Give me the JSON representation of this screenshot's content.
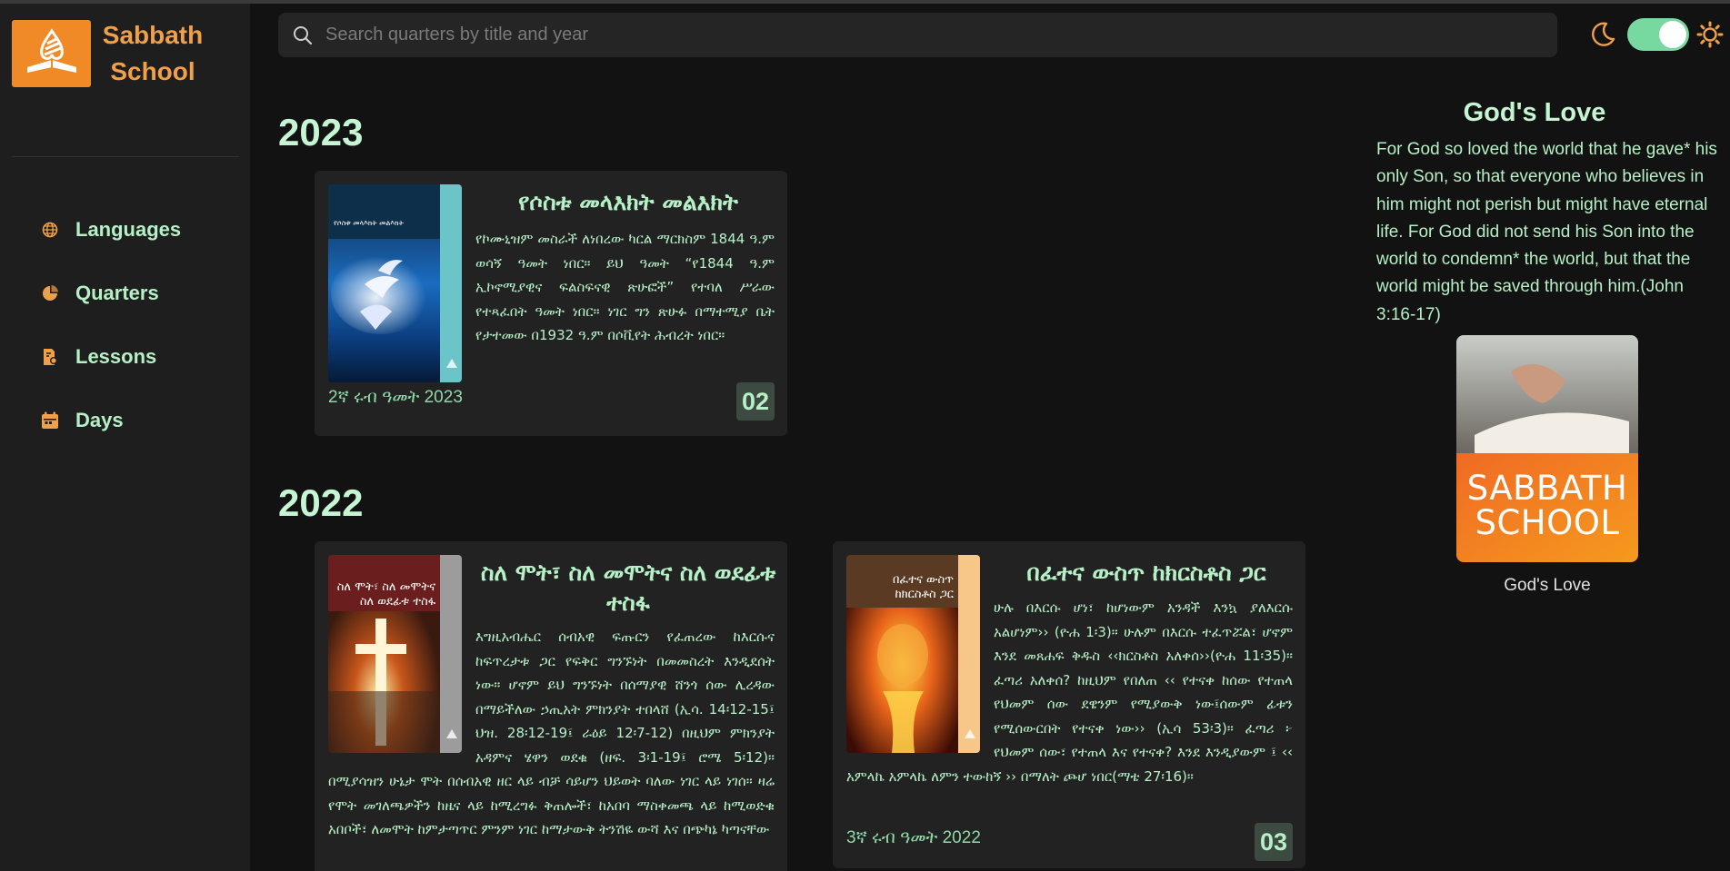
{
  "brand": {
    "line1": "Sabbath",
    "line2": "School"
  },
  "nav": [
    {
      "label": "Languages",
      "icon": "globe-icon"
    },
    {
      "label": "Quarters",
      "icon": "pie-icon"
    },
    {
      "label": "Lessons",
      "icon": "lesson-icon"
    },
    {
      "label": "Days",
      "icon": "calendar-icon"
    }
  ],
  "search": {
    "placeholder": "Search quarters by title and year"
  },
  "theme": {
    "moon_icon": "moon-icon",
    "sun_icon": "sun-icon",
    "dark_mode_on": true
  },
  "years": [
    {
      "year": "2023",
      "quarters": [
        {
          "title": "የሶስቱ መላእክት መልእክት",
          "cover_title": "የሶስቱ መላእክት መልእክት",
          "description": "የኮሙኒዝም መስራች ለነበረው ካርል ማርክስም 1844 ዓ.ም ወሳኝ ዓመት ነበር። ይህ ዓመት “የ1844 ዓ.ም ኢኮኖሚያዊና ፍልስፍናዊ ጽሁፎች” የተባለ ሥራው የተጻፈበት ዓመት ነበር። ነገር ግን ጽሁፉ በማተሚያ ቤት የታተመው በ1932 ዓ.ም በሶቪየት ሕብረት ነበር።",
          "quarter_label": "2ኛ ሩብ ዓመት 2023",
          "badge": "02"
        }
      ]
    },
    {
      "year": "2022",
      "quarters": [
        {
          "title": "ስለ ሞት፣ ስለ መሞትና ስለ ወደፊቱ ተስፋ",
          "cover_title": "ስለ ሞት፣ ስለ መሞትና ስለ ወደፊቱ ተስፋ",
          "description": "እግዚአብሔር ሰብአዊ ፍጡርን የፈጠረው ከእርሱና ከፍጥረታቱ ጋር የፍቅር ግንኙነት በመመስረት እንዲደሰት ነው። ሆኖም ይህ ግንኙነት በሰማያዊ ሸንጎ ሰው ሊረዳው በማይችለው ኃጢአት ምክንያት ተበላሸ (ኢሳ. 14፡12-15፤ ህዝ. 28፡12-19፤ ራዕይ 12፡7-12) በዚህም ምክንያት አዳምና ሄዋን ወደቁ (ዘፍ. 3፡1-19፤ ሮሜ 5፡12)። በሚያሳዝን ሁኔታ ሞት በሰብአዊ ዘር ላይ ብቻ ሳይሆን ህይወት ባለው ነገር ላይ ነገሰ። ዛሬ የሞት መገለጫዎችን ከዜና ላይ ከሚረግፉ ቅጠሎች፣ ከአበባ ማስቀመጫ ላይ ከሚወድቁ አበቦች፣ ለመሞት ከምታጣጥር ምንም ነገር ከማታውቅ ትንሽዬ ውሻ እና በጭካኔ ካጣናቸው",
          "quarter_label": "",
          "badge": ""
        },
        {
          "title": "በፈተና ውስጥ ከክርስቶስ ጋር",
          "cover_title": "በፈተና ውስጥ ከክርስቶስ ጋር",
          "description": "ሁሉ በእርሱ ሆነ፣ ከሆነውም አንዳች እንኳ ያለእርሱ አልሆነም›› (ዮሐ 1፡3)። ሁሉም በእርሱ ተፈጥሯል፣ ሆኖም እንደ መጸሐፍ ቅዱስ ‹‹ክርስቶስ አለቀሰ››(ዮሐ 11፡35)። ፈጣሪ አለቀሰ? ከዚህም የበለጠ ‹‹ የተናቀ ከሰው የተጠላ የህመም ሰው ደዌንም የሚያውቅ ነው፤ሰውም ፊቱን የሚሰውርበት የተናቀ ነው›› (ኢሳ 53፡3)። ፈጣሪ ፦ የህመም ሰው፣ የተጠላ እና የተናቀ? እንደ እንዲያውም ፤ ‹‹ አምላኬ አምላኬ ለምን ተውከኝ ›› በማለት ጮሆ ነበር(ማቴ 27፡16)።",
          "quarter_label": "3ኛ ሩብ ዓመት 2022",
          "badge": "03"
        }
      ]
    }
  ],
  "verse": {
    "title": "God's Love",
    "text": "For God so loved the world that he gave* his only Son, so that everyone who believes in him might not perish but might have eternal life. For God did not send his Son into the world to condemn* the world, but that the world might be saved through him.(John 3:16-17)",
    "image_line1": "SABBATH",
    "image_line2": "SCHOOL",
    "caption": "God's Love"
  },
  "colors": {
    "accent": "#f08a27",
    "text": "#b6f0c6",
    "toggle": "#77d8a0",
    "sun": "#f0a048"
  }
}
